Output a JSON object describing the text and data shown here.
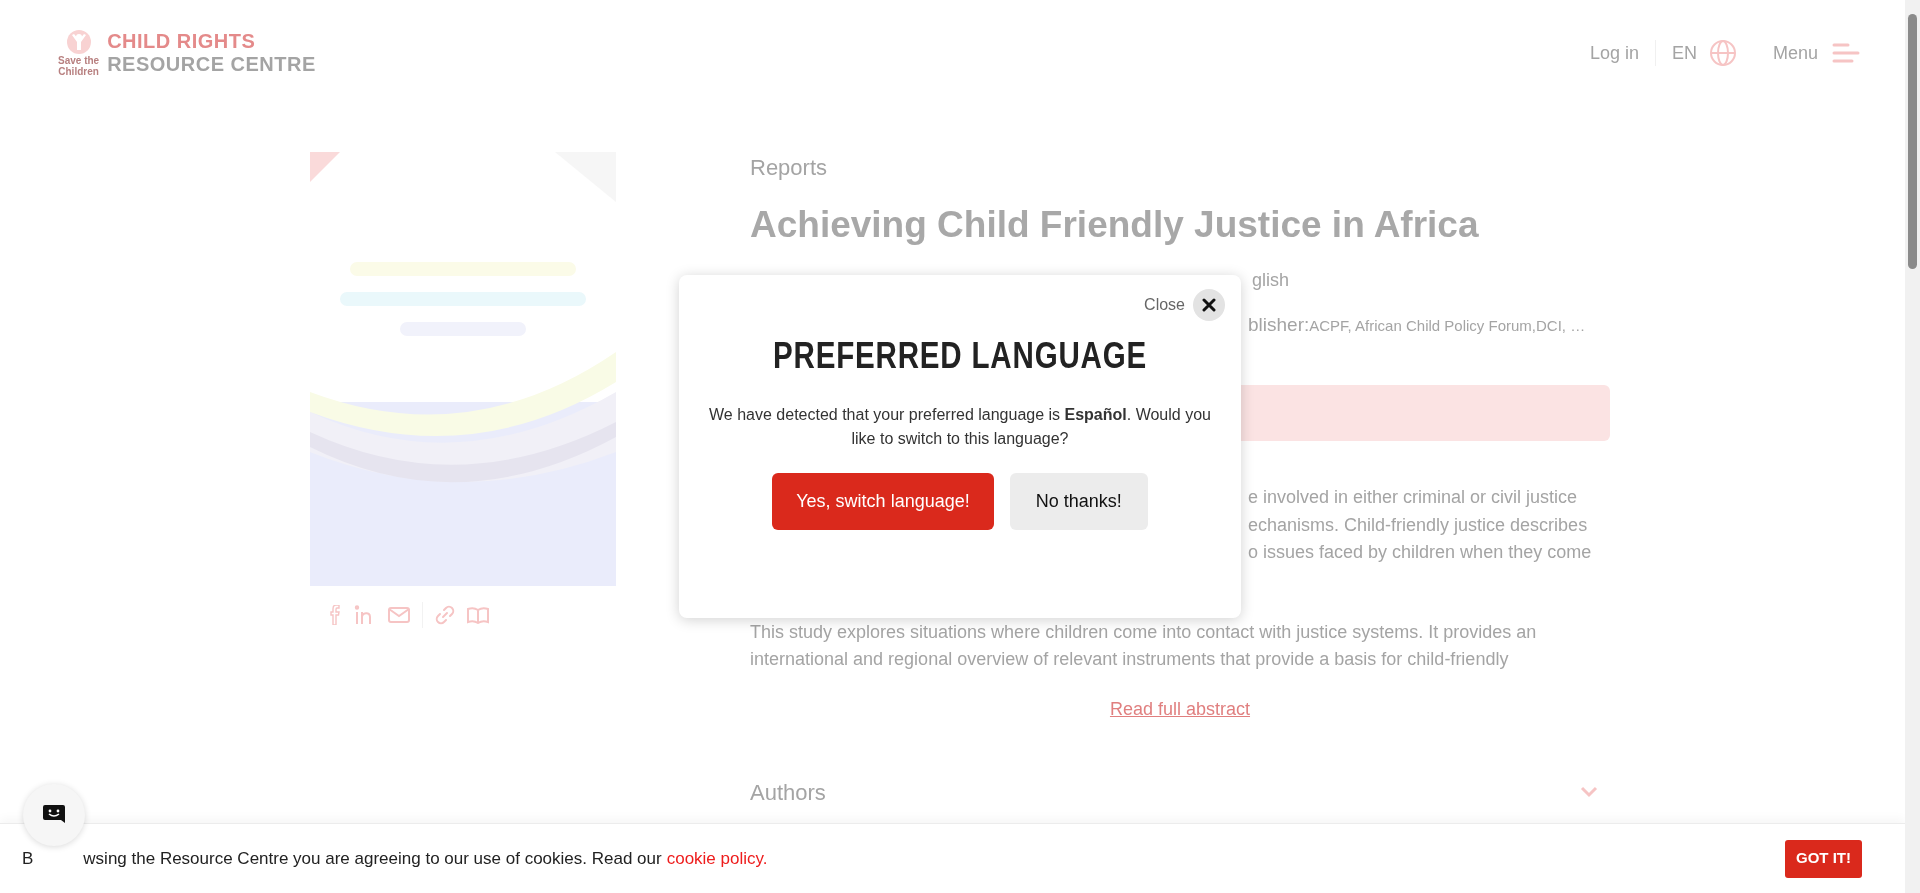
{
  "header": {
    "logo": {
      "org_line1": "Save the",
      "org_line2": "Children",
      "line1": "CHILD RIGHTS",
      "line2": "RESOURCE CENTRE"
    },
    "login": "Log in",
    "language": "EN",
    "menu": "Menu"
  },
  "document": {
    "category": "Reports",
    "title": "Achieving Child Friendly Justice in Africa",
    "language_fragment": "glish",
    "publisher_fragment": "blisher:",
    "publisher_value": "ACPF, African Child Policy Forum,DCI, …",
    "abstract_fragments": [
      "e involved in either criminal or civil justice",
      "echanisms. Child-friendly justice describes",
      "o issues faced by children when they come"
    ],
    "abstract_lines": [
      "This study explores situations where children come into contact with justice systems. It provides an",
      "international and regional overview of relevant instruments that provide a basis for child-friendly"
    ],
    "read_more": "Read full abstract"
  },
  "sections": [
    {
      "title": "Authors",
      "expanded": false
    }
  ],
  "modal": {
    "close_label": "Close",
    "title": "PREFERRED LANGUAGE",
    "message": "We have detected that your preferred language is **Español**. Would you like to switch to this language?",
    "buttons": [
      {
        "label": "Yes, switch language!",
        "kind": "primary"
      },
      {
        "label": "No thanks!",
        "kind": "secondary"
      }
    ]
  },
  "cookie_bar": {
    "text_start": "B",
    "text_rest": "wsing the Resource Centre you are agreeing to our use of cookies. Read our",
    "link": "cookie policy.",
    "button": "GOT IT!"
  }
}
